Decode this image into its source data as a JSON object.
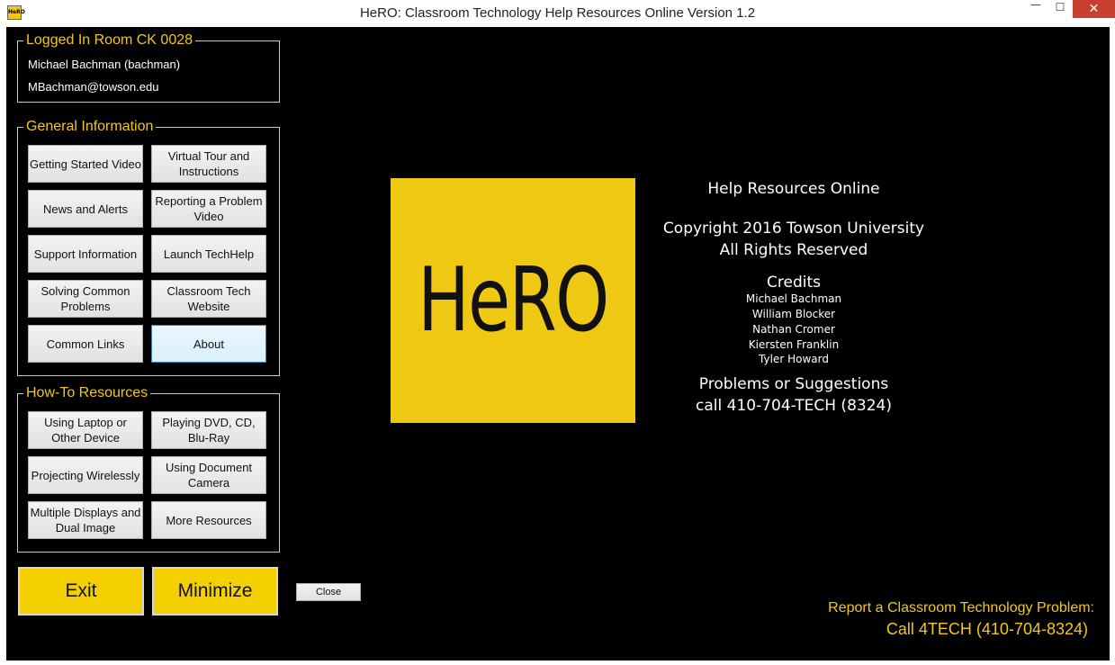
{
  "window": {
    "title": "HeRO: Classroom Technology Help Resources Online Version 1.2",
    "app_icon_text": "HeRO",
    "controls": {
      "minimize": "—",
      "maximize": "☐",
      "close": "✕"
    }
  },
  "logged_in": {
    "legend": "Logged In Room CK 0028",
    "user": "Michael Bachman (bachman)",
    "email": "MBachman@towson.edu"
  },
  "general_info": {
    "legend": "General Information",
    "buttons": [
      "Getting Started Video",
      "Virtual Tour and Instructions",
      "News and Alerts",
      "Reporting a Problem Video",
      "Support Information",
      "Launch TechHelp",
      "Solving Common Problems",
      "Classroom Tech Website",
      "Common Links",
      "About"
    ]
  },
  "howto": {
    "legend": "How-To Resources",
    "buttons": [
      "Using Laptop or Other Device",
      "Playing DVD, CD, Blu-Ray",
      "Projecting Wirelessly",
      "Using Document Camera",
      "Multiple Displays and Dual Image",
      "More Resources"
    ]
  },
  "actions": {
    "exit": "Exit",
    "minimize": "Minimize",
    "close": "Close"
  },
  "logo": {
    "text": "HeRO",
    "color": "#efc814"
  },
  "about": {
    "subtitle": "Help Resources Online",
    "copyright": "Copyright 2016 Towson University",
    "rights": "All Rights Reserved",
    "credits_heading": "Credits",
    "credits": [
      "Michael Bachman",
      "William Blocker",
      "Nathan Cromer",
      "Kiersten Franklin",
      "Tyler Howard"
    ],
    "problems_heading": "Problems or Suggestions",
    "problems_phone": "call 410-704-TECH (8324)"
  },
  "report": {
    "line1": "Report a Classroom Technology Problem:",
    "line2": "Call 4TECH (410-704-8324)"
  },
  "colors": {
    "accent": "#f2c811",
    "background": "#000000",
    "button_yellow": "#f5d000"
  }
}
